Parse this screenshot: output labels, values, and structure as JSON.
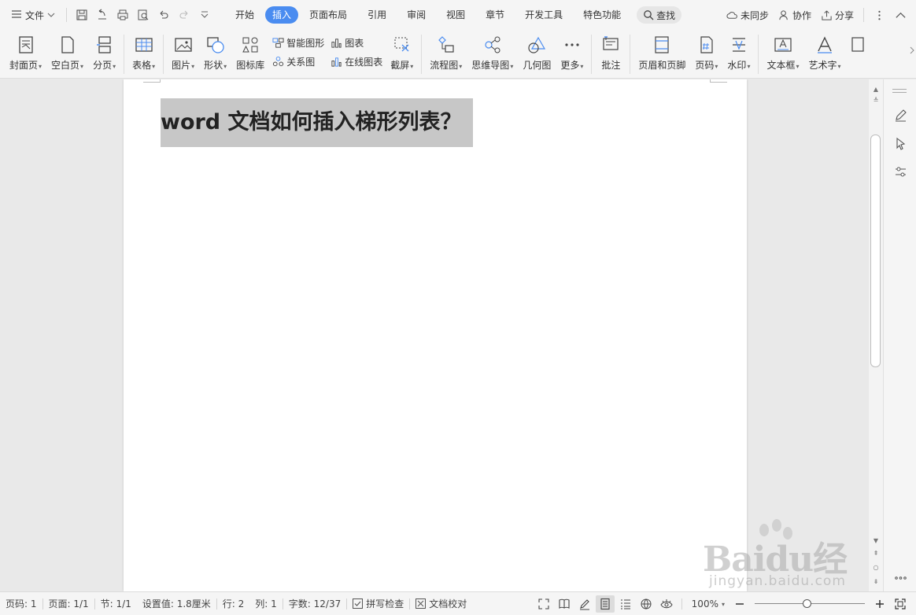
{
  "menubar": {
    "file_label": "文件",
    "tabs": [
      {
        "label": "开始"
      },
      {
        "label": "插入"
      },
      {
        "label": "页面布局"
      },
      {
        "label": "引用"
      },
      {
        "label": "审阅"
      },
      {
        "label": "视图"
      },
      {
        "label": "章节"
      },
      {
        "label": "开发工具"
      },
      {
        "label": "特色功能"
      }
    ],
    "active_tab": "插入",
    "search_label": "查找",
    "sync_label": "未同步",
    "collab_label": "协作",
    "share_label": "分享"
  },
  "ribbon": {
    "cover": "封面页",
    "blank": "空白页",
    "page_break": "分页",
    "table": "表格",
    "picture": "图片",
    "shape": "形状",
    "icon_lib": "图标库",
    "smart_art": "智能图形",
    "relation": "关系图",
    "chart": "图表",
    "online_chart": "在线图表",
    "screenshot": "截屏",
    "flowchart": "流程图",
    "mindmap": "思维导图",
    "geometry": "几何图",
    "more": "更多",
    "comment": "批注",
    "header_footer": "页眉和页脚",
    "page_num": "页码",
    "watermark": "水印",
    "textbox": "文本框",
    "wordart": "艺术字"
  },
  "document": {
    "heading": "word 文档如何插入梯形列表？"
  },
  "statusbar": {
    "page_num": "页码: 1",
    "pages": "页面: 1/1",
    "section": "节: 1/1",
    "setting": "设置值: 1.8厘米",
    "row": "行: 2",
    "col": "列: 1",
    "wordcount": "字数: 12/37",
    "spellcheck": "拼写检查",
    "doc_check": "文档校对",
    "zoom": "100%",
    "zoom_fraction": 0.47
  },
  "watermark": {
    "logo": "Baidu经验",
    "url": "jingyan.baidu.com"
  },
  "colors": {
    "accent": "#4a8cf0",
    "selection": "#c7c7c7"
  }
}
